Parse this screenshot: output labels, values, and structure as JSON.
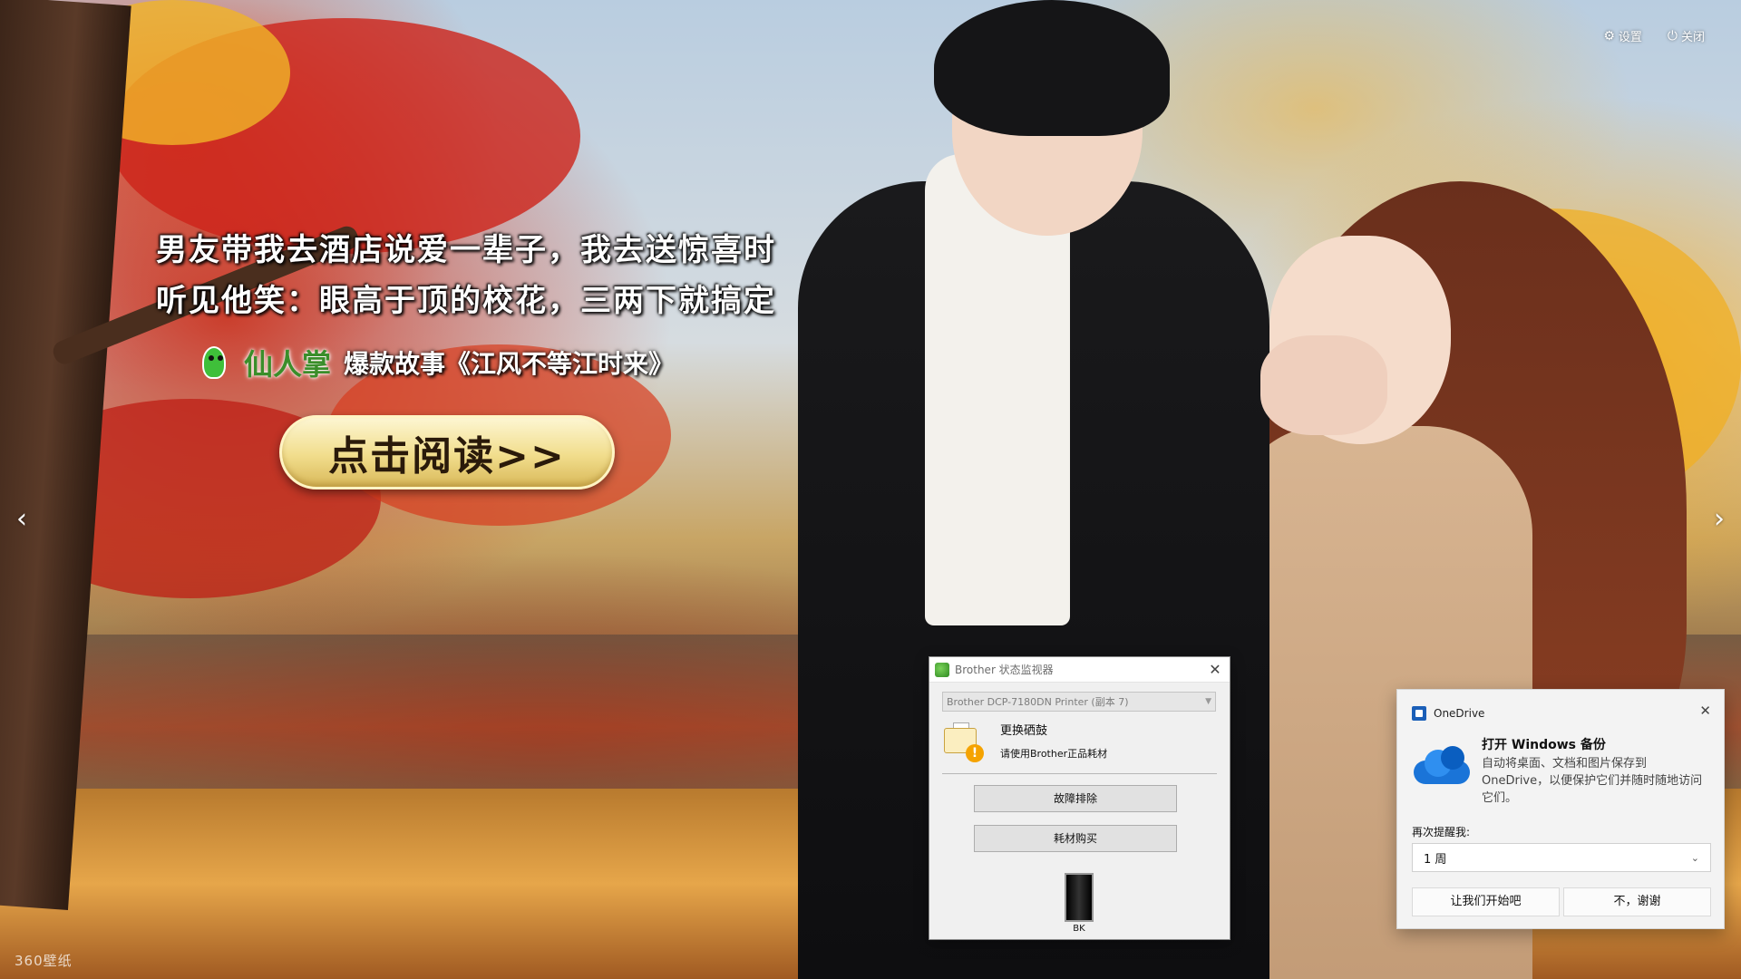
{
  "wallpaper": {
    "ad": {
      "headline_line1": "男友带我去酒店说爱一辈子，我去送惊喜时",
      "headline_line2": "听见他笑：眼高于顶的校花，三两下就搞定",
      "brand_name": "仙人掌",
      "story_title": "爆款故事《江风不等江时来》",
      "cta_label": "点击阅读>>",
      "brand_icon": "cactus-icon"
    },
    "controls": {
      "settings_label": "设置",
      "settings_icon": "gear-icon",
      "close_label": "关闭",
      "close_icon": "power-icon"
    },
    "nav": {
      "prev_glyph": "‹",
      "next_glyph": "›"
    },
    "watermark": "360壁纸"
  },
  "brother_monitor": {
    "title": "Brother 状态监视器",
    "printer_selected": "Brother DCP-7180DN Printer (副本 7)",
    "status_main": "更换硒鼓",
    "status_sub": "请使用Brother正品耗材",
    "troubleshoot_label": "故障排除",
    "buy_supplies_label": "耗材购买",
    "toner_label": "BK",
    "toner_color": "#000000",
    "status_icon": "printer-warning-icon"
  },
  "onedrive_toast": {
    "app_name": "OneDrive",
    "title": "打开 Windows 备份",
    "body": "自动将桌面、文档和图片保存到 OneDrive，以便保护它们并随时随地访问它们。",
    "remind_label": "再次提醒我:",
    "remind_value": "1 周",
    "primary_button": "让我们开始吧",
    "secondary_button": "不，谢谢",
    "accent_color": "#1a74d8"
  }
}
